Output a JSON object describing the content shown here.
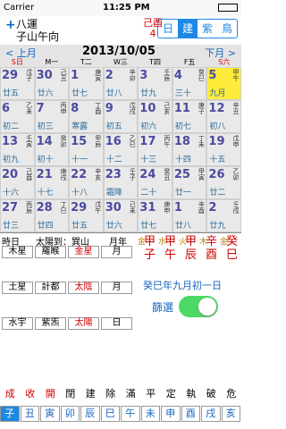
{
  "status": {
    "carrier": "Carrier",
    "time": "11:25 PM"
  },
  "header": {
    "left_line1": "八運",
    "left_line2": "子山午向",
    "add_icon": "plus-icon",
    "ganzhi": "己酉",
    "ganzhi_num": "4",
    "tabs": [
      "日",
      "建",
      "紫",
      "鳥"
    ],
    "active_tab": 1
  },
  "calendar": {
    "prev": "< 上月",
    "title": "2013/10/05",
    "next": "下月 >",
    "weekdays": [
      "S日",
      "M一",
      "T二",
      "W三",
      "T四",
      "F五",
      "S六"
    ],
    "weekday_colors": [
      "#d00000",
      "#000",
      "#000",
      "#000",
      "#000",
      "#000",
      "#d00000"
    ],
    "rows": [
      [
        {
          "n": "29",
          "g": "戊子",
          "l": "廿五"
        },
        {
          "n": "30",
          "g": "己丑",
          "l": "廿六"
        },
        {
          "n": "1",
          "g": "庚寅",
          "l": "廿七"
        },
        {
          "n": "2",
          "g": "辛卯",
          "l": "廿八"
        },
        {
          "n": "3",
          "g": "壬辰",
          "l": "廿九"
        },
        {
          "n": "4",
          "g": "癸巳",
          "l": "三十"
        },
        {
          "n": "5",
          "g": "甲午",
          "l": "九月"
        }
      ],
      [
        {
          "n": "6",
          "g": "乙未",
          "l": "初二"
        },
        {
          "n": "7",
          "g": "丙申",
          "l": "初三"
        },
        {
          "n": "8",
          "g": "丁酉",
          "l": "寒露"
        },
        {
          "n": "9",
          "g": "戊戌",
          "l": "初五"
        },
        {
          "n": "10",
          "g": "己亥",
          "l": "初六"
        },
        {
          "n": "11",
          "g": "庚子",
          "l": "初七"
        },
        {
          "n": "12",
          "g": "辛丑",
          "l": "初八"
        }
      ],
      [
        {
          "n": "13",
          "g": "壬寅",
          "l": "初九"
        },
        {
          "n": "14",
          "g": "癸卯",
          "l": "初十"
        },
        {
          "n": "15",
          "g": "甲辰",
          "l": "十一"
        },
        {
          "n": "16",
          "g": "乙巳",
          "l": "十二"
        },
        {
          "n": "17",
          "g": "丙午",
          "l": "十三"
        },
        {
          "n": "18",
          "g": "丁未",
          "l": "十四"
        },
        {
          "n": "19",
          "g": "戊申",
          "l": "十五"
        }
      ],
      [
        {
          "n": "20",
          "g": "己酉",
          "l": "十六"
        },
        {
          "n": "21",
          "g": "庚戌",
          "l": "十七"
        },
        {
          "n": "22",
          "g": "辛亥",
          "l": "十八"
        },
        {
          "n": "23",
          "g": "壬子",
          "l": "霜降"
        },
        {
          "n": "24",
          "g": "癸丑",
          "l": "二十"
        },
        {
          "n": "25",
          "g": "甲寅",
          "l": "廿一"
        },
        {
          "n": "26",
          "g": "乙卯",
          "l": "廿二"
        }
      ],
      [
        {
          "n": "27",
          "g": "丙辰",
          "l": "廿三"
        },
        {
          "n": "28",
          "g": "丁巳",
          "l": "廿四"
        },
        {
          "n": "29",
          "g": "戊午",
          "l": "廿五"
        },
        {
          "n": "30",
          "g": "己未",
          "l": "廿六"
        },
        {
          "n": "31",
          "g": "庚申",
          "l": "廿七"
        },
        {
          "n": "1",
          "g": "辛酉",
          "l": "廿八"
        },
        {
          "n": "2",
          "g": "壬戌",
          "l": "廿九"
        }
      ]
    ]
  },
  "panel": {
    "label_time": "時日",
    "label_sun": "太陽到：巽山",
    "label_month": "月年",
    "stars_row1": [
      "木星",
      "羅睺",
      "金星",
      "月"
    ],
    "stars_row2": [
      "土星",
      "計都",
      "太陰",
      "月"
    ],
    "stars_row3": [
      "水宇",
      "紫炁",
      "太陽",
      "日"
    ],
    "ganzhi_cols": [
      {
        "top": "金",
        "main": "甲子"
      },
      {
        "top": "水",
        "main": "甲午"
      },
      {
        "top": "火",
        "main": "甲辰"
      },
      {
        "top": "木",
        "main": "辛酉"
      },
      {
        "top": "金",
        "main": "癸巳"
      }
    ],
    "lunar_date": "癸巳年九月初一日",
    "filter_label": "篩選"
  },
  "bottom": {
    "officers": [
      "成",
      "收",
      "開",
      "閉",
      "建",
      "除",
      "滿",
      "平",
      "定",
      "執",
      "破",
      "危"
    ],
    "branches": [
      "子",
      "丑",
      "寅",
      "卯",
      "辰",
      "巳",
      "午",
      "未",
      "申",
      "酉",
      "戌",
      "亥"
    ]
  }
}
